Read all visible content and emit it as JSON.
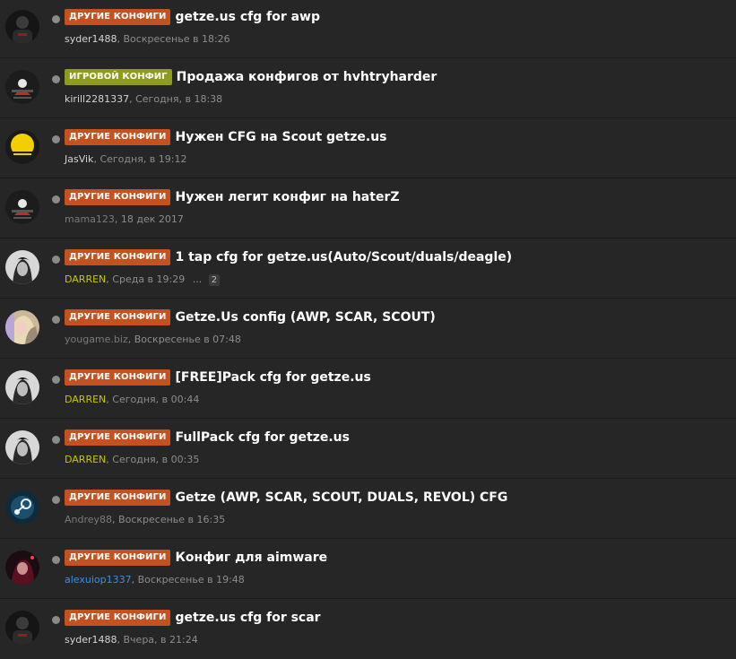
{
  "prefixes": {
    "other": "Другие конфиги",
    "game": "Игровой конфиг"
  },
  "threads": [
    {
      "title": "getze.us cfg for awp",
      "author": "syder1488",
      "sep": ",",
      "date": "Воскресенье в 18:26"
    },
    {
      "title": "Продажа конфигов от hvhtryharder",
      "author": "kirill2281337",
      "sep": ",",
      "date": "Сегодня, в 18:38"
    },
    {
      "title": "Нужен CFG на Scout getze.us",
      "author": "JasVik",
      "sep": ",",
      "date": "Сегодня, в 19:12"
    },
    {
      "title": "Нужен легит конфиг на haterZ",
      "author": "mama123",
      "sep": ",",
      "date": "18 дек 2017"
    },
    {
      "title": "1 tap cfg for getze.us(Auto/Scout/duals/deagle)",
      "author": "DARREN",
      "sep": ",",
      "date": "Среда в 19:29",
      "ellipsis": "...",
      "page": "2"
    },
    {
      "title": "Getze.Us config (AWP, SCAR, SCOUT)",
      "author": "yougame.biz",
      "sep": ",",
      "date": "Воскресенье в 07:48"
    },
    {
      "title": "[FREE]Pack cfg for getze.us",
      "author": "DARREN",
      "sep": ",",
      "date": "Сегодня, в 00:44"
    },
    {
      "title": "FullPack cfg for getze.us",
      "author": "DARREN",
      "sep": ",",
      "date": "Сегодня, в 00:35"
    },
    {
      "title": "Getze (AWP, SCAR, SCOUT, DUALS, REVOL) CFG",
      "author": "Andrey88",
      "sep": ",",
      "date": "Воскресенье в 16:35"
    },
    {
      "title": "Конфиг для aimware",
      "author": "alexuiop1337",
      "sep": ",",
      "date": "Воскресенье в 19:48"
    },
    {
      "title": "getze.us cfg for scar",
      "author": "syder1488",
      "sep": ",",
      "date": "Вчера, в 21:24"
    }
  ],
  "colors": {
    "background": "#262626",
    "prefix_other": "#c45220",
    "prefix_game": "#8f9b1d",
    "author_yellow": "#c8c800",
    "author_blue": "#3a8ee6"
  }
}
